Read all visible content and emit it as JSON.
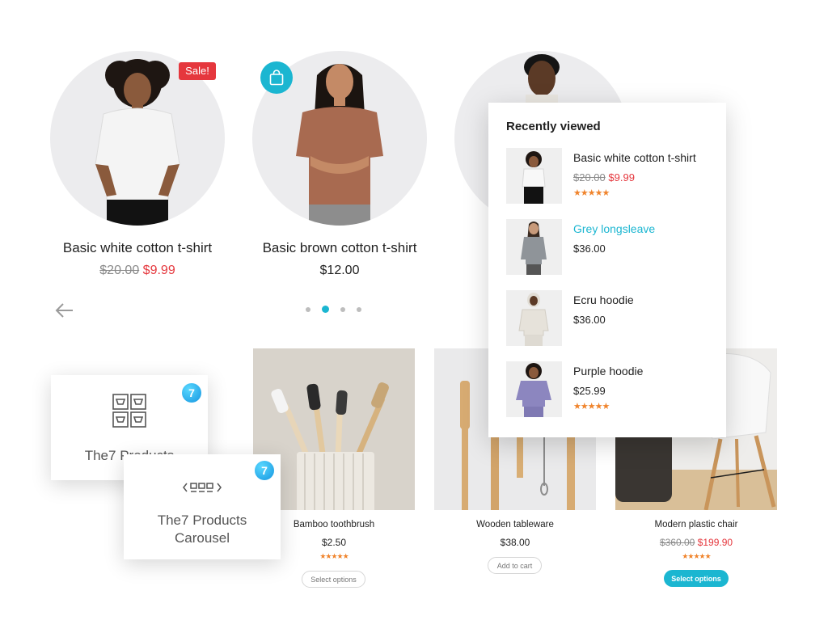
{
  "carousel": {
    "products": [
      {
        "title": "Basic white cotton t-shirt",
        "old_price": "$20.00",
        "price": "$9.99",
        "badge": "Sale!"
      },
      {
        "title": "Basic brown cotton t-shirt",
        "price": "$12.00"
      }
    ],
    "dots_count": 4,
    "active_dot": 2
  },
  "recently_viewed": {
    "title": "Recently viewed",
    "items": [
      {
        "name": "Basic white cotton t-shirt",
        "old_price": "$20.00",
        "price": "$9.99",
        "rating": 5,
        "stars": "★★★★★"
      },
      {
        "name": "Grey longsleave",
        "price": "$36.00"
      },
      {
        "name": "Ecru hoodie",
        "price": "$36.00"
      },
      {
        "name": "Purple hoodie",
        "price": "$25.99",
        "rating": 5,
        "stars": "★★★★★"
      }
    ]
  },
  "grid": {
    "products": [
      {
        "title": "Bamboo toothbrush",
        "price": "$2.50",
        "rating": 5,
        "stars": "★★★★★",
        "button": "Select options"
      },
      {
        "title": "Wooden tableware",
        "price": "$38.00",
        "button": "Add to cart"
      },
      {
        "title": "Modern plastic chair",
        "old_price": "$360.00",
        "price": "$199.90",
        "rating": 4.5,
        "stars": "★★★★★",
        "button": "Select options"
      }
    ]
  },
  "widgets": {
    "products": {
      "label": "The7 Products",
      "badge": "7"
    },
    "carousel": {
      "label_line1": "The7 Products",
      "label_line2": "Carousel",
      "badge": "7"
    }
  },
  "colors": {
    "accent": "#1bb6d1",
    "sale": "#e5373d",
    "stars": "#f0842c"
  }
}
